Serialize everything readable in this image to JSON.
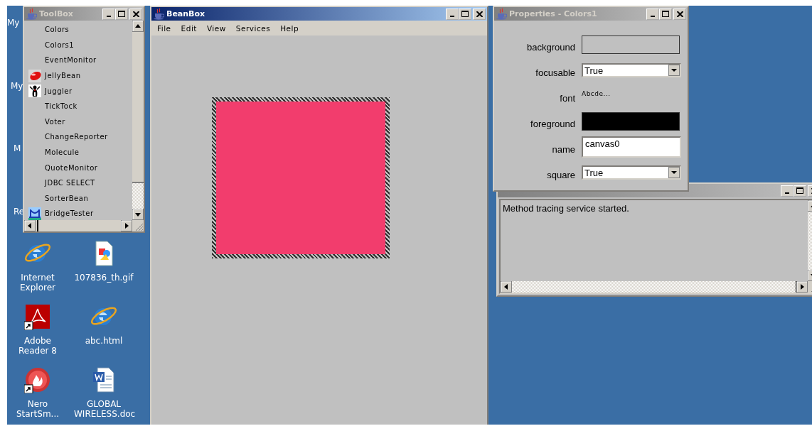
{
  "desktop": {
    "partial_labels": [
      "My",
      "My",
      "M",
      "Re"
    ],
    "icons": [
      {
        "kind": "browser",
        "label": "Internet Explorer",
        "shortcut": false
      },
      {
        "kind": "image_file",
        "label": "107836_th.gif",
        "shortcut": false
      },
      {
        "kind": "pdf_reader",
        "label": "Adobe Reader 8",
        "shortcut": true
      },
      {
        "kind": "browser",
        "label": "abc.html",
        "shortcut": false
      },
      {
        "kind": "burner",
        "label": "Nero StartSm...",
        "shortcut": true
      },
      {
        "kind": "word_doc",
        "label": "GLOBAL WIRELESS.doc",
        "shortcut": false
      }
    ]
  },
  "toolbox": {
    "title": "ToolBox",
    "active": false,
    "items": [
      {
        "label": "Colors",
        "kind": "plain"
      },
      {
        "label": "Colors1",
        "kind": "plain"
      },
      {
        "label": "EventMonitor",
        "kind": "plain"
      },
      {
        "label": "JellyBean",
        "kind": "jellybean"
      },
      {
        "label": "Juggler",
        "kind": "juggler"
      },
      {
        "label": "TickTock",
        "kind": "plain"
      },
      {
        "label": "Voter",
        "kind": "plain"
      },
      {
        "label": "ChangeReporter",
        "kind": "plain"
      },
      {
        "label": "Molecule",
        "kind": "plain"
      },
      {
        "label": "QuoteMonitor",
        "kind": "plain"
      },
      {
        "label": "JDBC SELECT",
        "kind": "plain"
      },
      {
        "label": "SorterBean",
        "kind": "plain"
      },
      {
        "label": "BridgeTester",
        "kind": "bridge"
      }
    ]
  },
  "beanbox": {
    "title": "BeanBox",
    "active": true,
    "menu": [
      "File",
      "Edit",
      "View",
      "Services",
      "Help"
    ],
    "bean": {
      "selected": true
    }
  },
  "properties": {
    "title": "Properties - Colors1",
    "active": false,
    "rows": [
      {
        "label": "background",
        "kind": "color",
        "color": "#c0c0c0"
      },
      {
        "label": "focusable",
        "kind": "choice",
        "value": "True"
      },
      {
        "label": "font",
        "kind": "text",
        "value": "Abcde..."
      },
      {
        "label": "foreground",
        "kind": "color",
        "color": "#000000"
      },
      {
        "label": "name",
        "kind": "field",
        "value": "canvas0"
      },
      {
        "label": "square",
        "kind": "choice",
        "value": "True"
      }
    ]
  },
  "method_tracer": {
    "active": false,
    "log": "Method tracing service started."
  }
}
